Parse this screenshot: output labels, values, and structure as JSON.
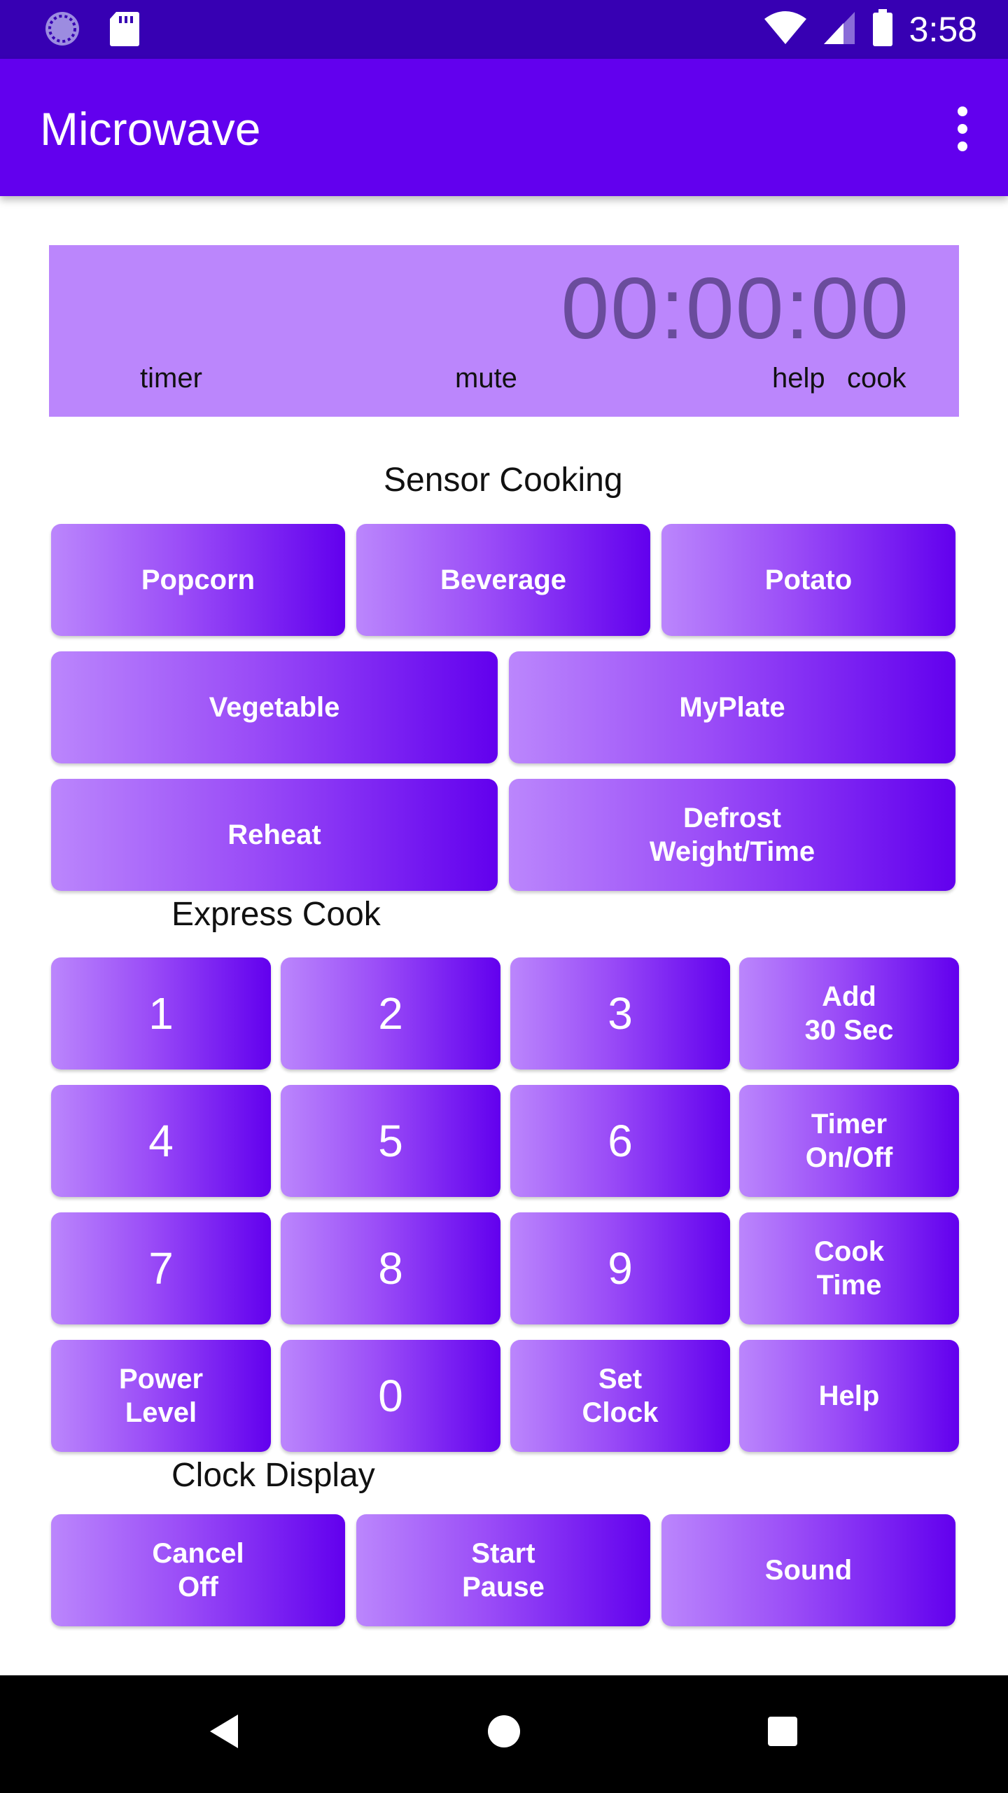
{
  "status_bar": {
    "time": "3:58",
    "icons": [
      "loading-icon",
      "sd-card-icon",
      "wifi-icon",
      "signal-icon",
      "battery-icon"
    ]
  },
  "app_bar": {
    "title": "Microwave",
    "menu_icon": "overflow-menu-icon"
  },
  "display": {
    "time": "00:00:00",
    "labels": {
      "timer": "timer",
      "mute": "mute",
      "help": "help",
      "cook": "cook"
    }
  },
  "sections": {
    "sensor_cooking": "Sensor Cooking",
    "express_cook": "Express Cook",
    "clock_display": "Clock Display"
  },
  "sensor_buttons": {
    "popcorn": "Popcorn",
    "beverage": "Beverage",
    "potato": "Potato",
    "vegetable": "Vegetable",
    "myplate": "MyPlate",
    "reheat": "Reheat",
    "defrost": "Defrost\nWeight/Time"
  },
  "keypad": {
    "k1": "1",
    "k2": "2",
    "k3": "3",
    "add30": "Add\n30 Sec",
    "k4": "4",
    "k5": "5",
    "k6": "6",
    "timer": "Timer\nOn/Off",
    "k7": "7",
    "k8": "8",
    "k9": "9",
    "cooktime": "Cook\nTime",
    "power": "Power\nLevel",
    "k0": "0",
    "setclock": "Set\nClock",
    "help": "Help"
  },
  "bottom_buttons": {
    "cancel": "Cancel\nOff",
    "start": "Start\nPause",
    "sound": "Sound"
  },
  "colors": {
    "status_bar": "#3700b3",
    "app_bar": "#6200ee",
    "display_bg": "#bb86fc",
    "display_digits": "#6a4c9c",
    "button_gradient_start": "#bb86fc",
    "button_gradient_end": "#6200ee"
  },
  "nav_bar": {
    "back": "back-icon",
    "home": "home-icon",
    "recents": "recents-icon"
  }
}
